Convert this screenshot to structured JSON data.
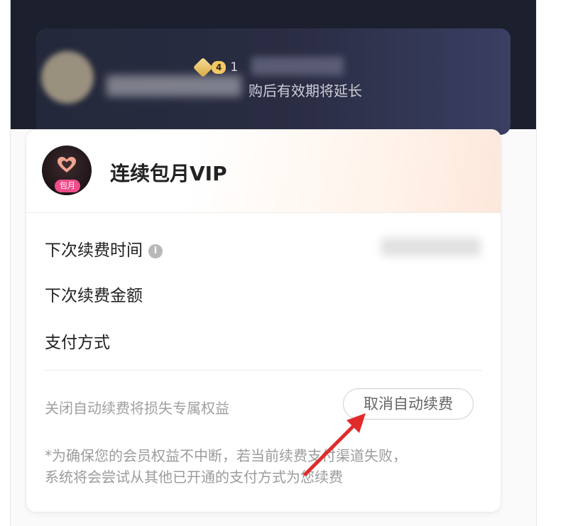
{
  "member": {
    "level": "4",
    "level_text": "1",
    "subtitle": "购后有效期将延长"
  },
  "vip": {
    "title": "连续包月VIP",
    "badge": "包月",
    "next_renewal_time_label": "下次续费时间",
    "next_renewal_amount_label": "下次续费金额",
    "payment_method_label": "支付方式",
    "warning": "关闭自动续费将损失专属权益",
    "cancel_button": "取消自动续费",
    "note_line1": "*为确保您的会员权益不中断，若当前续费支付渠道失败，",
    "note_line2": "系统将会尝试从其他已开通的支付方式为您续费"
  },
  "colors": {
    "header_bg": "#1c1f2e",
    "arrow": "#e12b2b",
    "badge_pink": "#f04d8a"
  }
}
